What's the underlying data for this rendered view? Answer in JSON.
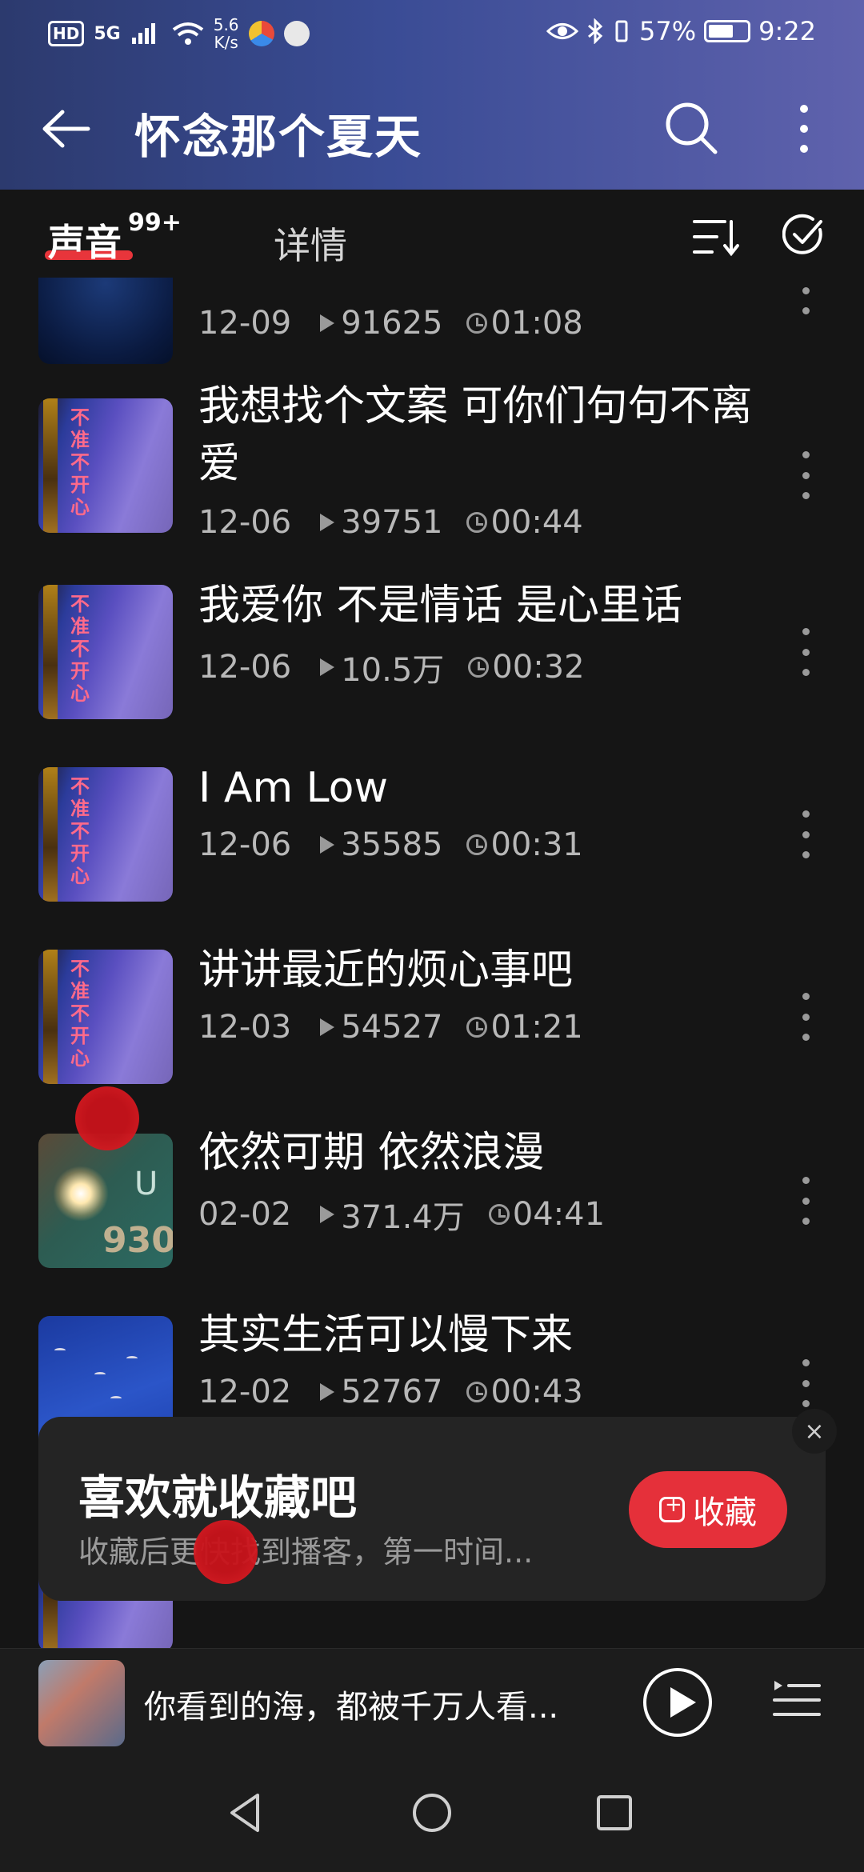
{
  "status_bar": {
    "hd": "HD",
    "net": "5G",
    "speed_value": "5.6",
    "speed_unit": "K/s",
    "battery_percent": "57%",
    "time": "9:22"
  },
  "header": {
    "title": "怀念那个夏天"
  },
  "tabs": {
    "sound_label": "声音",
    "sound_badge": "99+",
    "detail_label": "详情"
  },
  "list": {
    "items": [
      {
        "title": "",
        "date": "12-09",
        "plays": "91625",
        "duration": "01:08"
      },
      {
        "title": "我想找个文案 可你们句句不离爱",
        "date": "12-06",
        "plays": "39751",
        "duration": "00:44"
      },
      {
        "title": "我爱你 不是情话 是心里话",
        "date": "12-06",
        "plays": "10.5万",
        "duration": "00:32"
      },
      {
        "title": "I Am Low",
        "date": "12-06",
        "plays": "35585",
        "duration": "00:31"
      },
      {
        "title": "讲讲最近的烦心事吧",
        "date": "12-03",
        "plays": "54527",
        "duration": "01:21"
      },
      {
        "title": "依然可期 依然浪漫",
        "date": "02-02",
        "plays": "371.4万",
        "duration": "04:41"
      },
      {
        "title": "其实生活可以慢下来",
        "date": "12-02",
        "plays": "52767",
        "duration": "00:43"
      }
    ],
    "art_text": {
      "vertical": "不准不开心",
      "u": "U",
      "n": "930"
    }
  },
  "promo": {
    "title": "喜欢就收藏吧",
    "subtitle": "收藏后更快找到播客，第一时间...",
    "button_label": "收藏",
    "close": "×"
  },
  "player": {
    "title": "你看到的海，都被千万人看..."
  },
  "colors": {
    "accent": "#e5303a",
    "header_start": "#2c3a6e",
    "header_end": "#5f62ad",
    "background": "#151515"
  }
}
